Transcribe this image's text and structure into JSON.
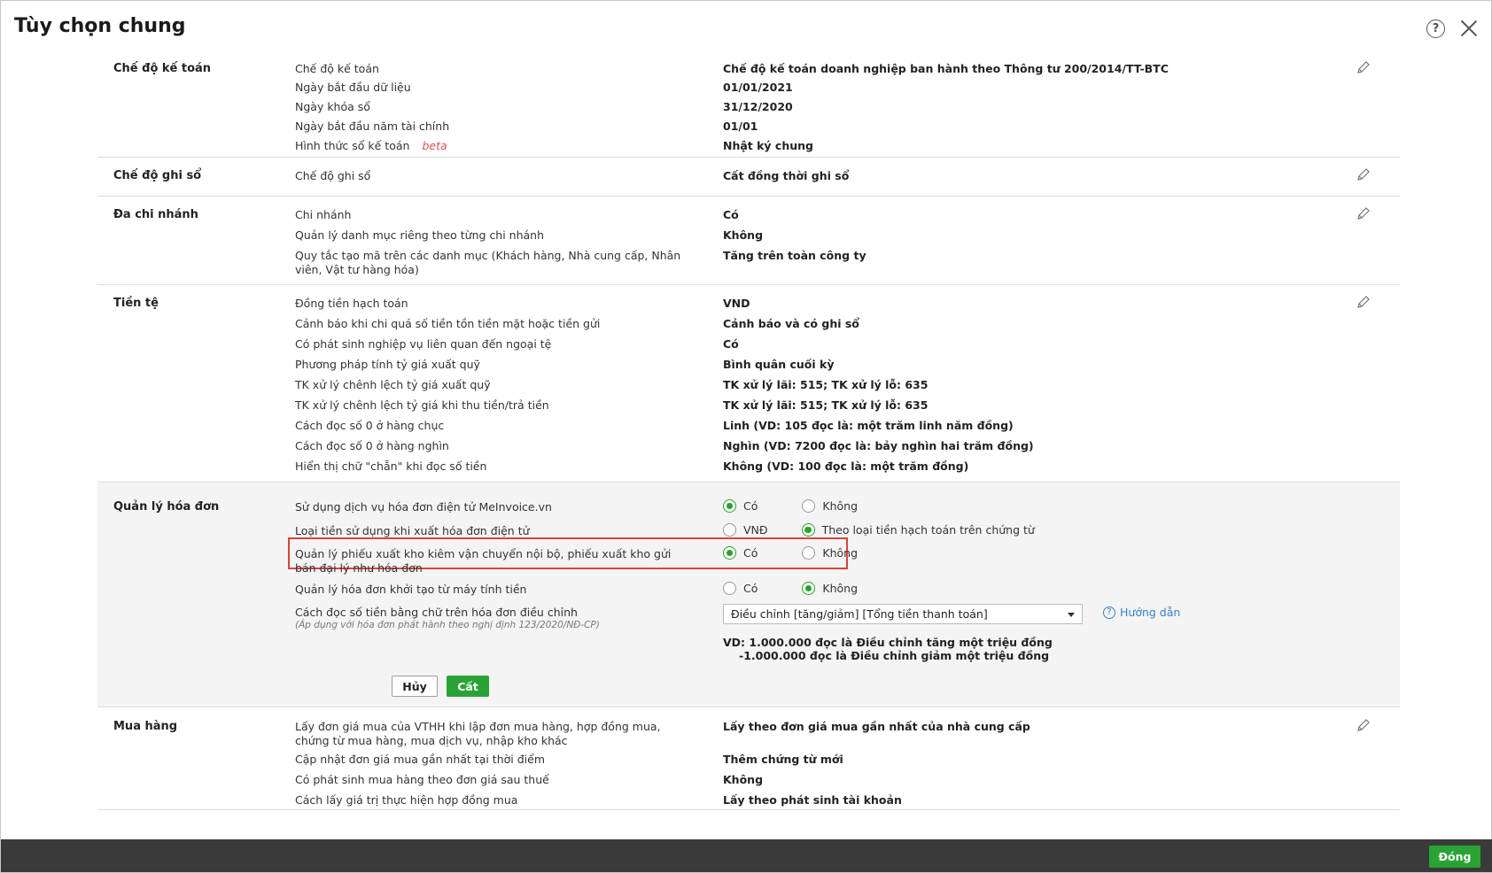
{
  "title": "Tùy chọn chung",
  "sections": {
    "s1": {
      "title": "Chế độ kế toán",
      "rows": [
        {
          "label": "Chế độ kế toán",
          "value": "Chế độ kế toán doanh nghiệp ban hành theo Thông tư 200/2014/TT-BTC"
        },
        {
          "label": "Ngày bắt đầu dữ liệu",
          "value": "01/01/2021"
        },
        {
          "label": "Ngày khóa sổ",
          "value": "31/12/2020"
        },
        {
          "label": "Ngày bắt đầu năm tài chính",
          "value": "01/01"
        },
        {
          "label": "Hình thức sổ kế toán",
          "value": "Nhật ký chung",
          "badge": "beta"
        }
      ]
    },
    "s2": {
      "title": "Chế độ ghi sổ",
      "rows": [
        {
          "label": "Chế độ ghi sổ",
          "value": "Cất đồng thời ghi sổ"
        }
      ]
    },
    "s3": {
      "title": "Đa chi nhánh",
      "rows": [
        {
          "label": "Chi nhánh",
          "value": "Có"
        },
        {
          "label": "Quản lý danh mục riêng theo từng chi nhánh",
          "value": "Không"
        },
        {
          "label": "Quy tắc tạo mã trên các danh mục (Khách hàng, Nhà cung cấp, Nhân viên, Vật tư hàng hóa)",
          "value": "Tăng trên toàn công ty"
        }
      ]
    },
    "s4": {
      "title": "Tiền tệ",
      "rows": [
        {
          "label": "Đồng tiền hạch toán",
          "value": "VND"
        },
        {
          "label": "Cảnh báo khi chi quá số tiền tồn tiền mặt hoặc tiền gửi",
          "value": "Cảnh báo và có ghi sổ"
        },
        {
          "label": "Có phát sinh nghiệp vụ liên quan đến ngoại tệ",
          "value": "Có"
        },
        {
          "label": "Phương pháp tính tỷ giá xuất quỹ",
          "value": "Bình quân cuối kỳ"
        },
        {
          "label": "TK xử lý chênh lệch tỷ giá xuất quỹ",
          "value": "TK xử lý lãi: 515; TK xử lý lỗ: 635"
        },
        {
          "label": "TK xử lý chênh lệch tỷ giá khi thu tiền/trả tiền",
          "value": "TK xử lý lãi: 515; TK xử lý lỗ: 635"
        },
        {
          "label": "Cách đọc số 0 ở hàng chục",
          "value": "Linh (VD: 105 đọc là: một trăm linh năm đồng)"
        },
        {
          "label": "Cách đọc số 0 ở hàng nghìn",
          "value": "Nghìn (VD: 7200 đọc là: bảy nghìn hai trăm đồng)"
        },
        {
          "label": "Hiển thị chữ \"chẵn\" khi đọc số tiền",
          "value": "Không (VD: 100 đọc là: một trăm đồng)"
        }
      ]
    },
    "s5": {
      "title": "Quản lý hóa đơn",
      "r1": {
        "label": "Sử dụng dịch vụ hóa đơn điện tử MeInvoice.vn",
        "opt1": "Có",
        "opt2": "Không",
        "selected": 1
      },
      "r2": {
        "label": "Loại tiền sử dụng khi xuất hóa đơn điện tử",
        "opt1": "VNĐ",
        "opt2": "Theo loại tiền hạch toán trên chứng từ",
        "selected": 2
      },
      "r3": {
        "label": "Quản lý phiếu xuất kho kiêm vận chuyển nội bộ, phiếu xuất kho gửi bán đại lý như hóa đơn",
        "opt1": "Có",
        "opt2": "Không",
        "selected": 1
      },
      "r4": {
        "label": "Quản lý hóa đơn khởi tạo từ máy tính tiền",
        "opt1": "Có",
        "opt2": "Không",
        "selected": 2
      },
      "r5": {
        "label": "Cách đọc số tiền bằng chữ trên hóa đơn điều chỉnh",
        "note": "(Áp dụng với hóa đơn phát hành theo nghị định 123/2020/NĐ-CP)",
        "select_value": "Điều chỉnh [tăng/giảm] [Tổng tiền thanh toán]",
        "guide": "Hướng dẫn",
        "example1": "VD: 1.000.000 đọc là Điều chỉnh tăng một triệu đồng",
        "example2": "-1.000.000 đọc là Điều chỉnh giảm một triệu đồng"
      },
      "cancel": "Hủy",
      "save": "Cất"
    },
    "s6": {
      "title": "Mua hàng",
      "rows": [
        {
          "label": "Lấy đơn giá mua của VTHH khi lập đơn mua hàng, hợp đồng mua, chứng từ mua hàng, mua dịch vụ, nhập kho khác",
          "value": "Lấy theo đơn giá mua gần nhất của nhà cung cấp"
        },
        {
          "label": "Cập nhật đơn giá mua gần nhất tại thời điểm",
          "value": "Thêm chứng từ mới"
        },
        {
          "label": "Có phát sinh mua hàng theo đơn giá sau thuế",
          "value": "Không"
        },
        {
          "label": "Cách lấy giá trị thực hiện hợp đồng mua",
          "value": "Lấy theo phát sinh tài khoản"
        }
      ]
    }
  },
  "footer": {
    "close": "Đóng"
  },
  "colors": {
    "accent": "#2aa335",
    "highlight_border": "#d9443c",
    "link": "#3b82c4",
    "footer_bg": "#3a3a3a"
  },
  "icons": {
    "help": "help-circle-icon",
    "close": "close-icon",
    "edit": "pencil-icon",
    "guide": "help-circle-icon"
  }
}
